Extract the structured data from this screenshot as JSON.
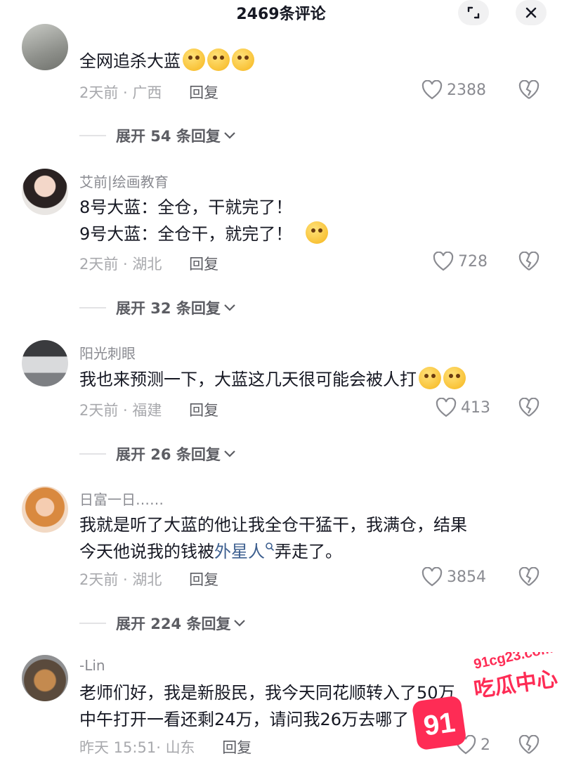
{
  "header": {
    "title": "2469条评论",
    "expand_icon": "expand-icon",
    "close_icon": "close-icon"
  },
  "comments": [
    {
      "username": "",
      "text": [
        "全网追杀大蓝"
      ],
      "emoji_count": 3,
      "time": "2天前",
      "location": "广西",
      "reply_label": "回复",
      "likes": "2388",
      "expand_label": "展开 54 条回复"
    },
    {
      "username": "艾前|绘画教育",
      "text": [
        "8号大蓝：全仓，干就完了！",
        "9号大蓝：全仓干，就完了！"
      ],
      "emoji_count": 1,
      "time": "2天前",
      "location": "湖北",
      "reply_label": "回复",
      "likes": "728",
      "expand_label": "展开 32 条回复"
    },
    {
      "username": "阳光刺眼",
      "text": [
        "我也来预测一下，大蓝这几天很可能会被人打"
      ],
      "emoji_count": 2,
      "time": "2天前",
      "location": "福建",
      "reply_label": "回复",
      "likes": "413",
      "expand_label": "展开 26 条回复"
    },
    {
      "username": "日富一日……",
      "text_line1": "我就是听了大蓝的他让我全仓干猛干，我满仓，结果",
      "text_line2_prefix": "今天他说我的钱被",
      "text_line2_link": "外星人",
      "text_line2_suffix": "弄走了。",
      "time": "2天前",
      "location": "湖北",
      "reply_label": "回复",
      "likes": "3854",
      "expand_label": "展开 224 条回复"
    },
    {
      "username": "-Lin",
      "text": [
        "老师们好，我是新股民，我今天同花顺转入了50万",
        "中午打开一看还剩24万，请问我26万去哪了"
      ],
      "time": "昨天 15:51",
      "location": "山东",
      "reply_label": "回复",
      "likes": "2"
    }
  ],
  "watermark": {
    "url": "91cg23.com",
    "brand": "吃瓜中心",
    "logo_text": "91"
  },
  "colors": {
    "accent_pink": "#fe2c55",
    "link": "#3d5f8f",
    "meta": "#a8a9ad"
  }
}
